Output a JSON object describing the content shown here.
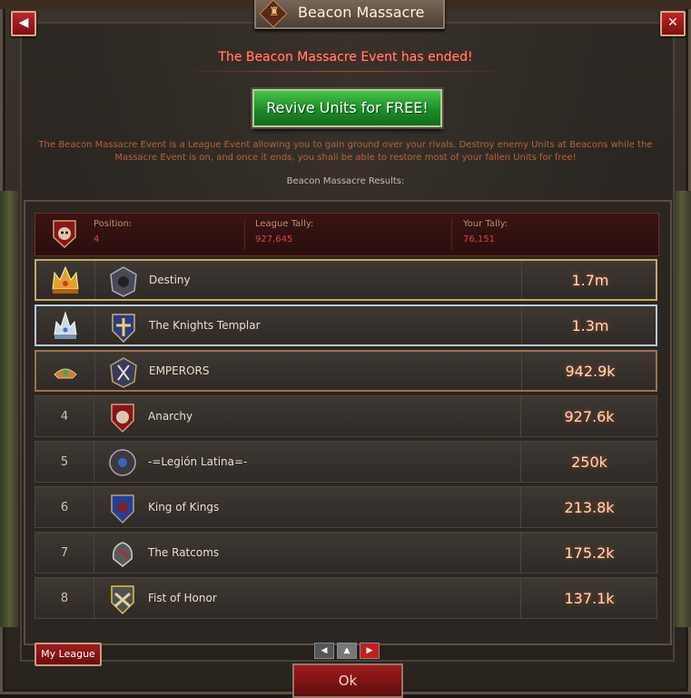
{
  "window": {
    "title": "Beacon Massacre",
    "back_label": "◀",
    "close_label": "✕"
  },
  "event": {
    "status_text": "The Beacon Massacre Event has ended!",
    "revive_label": "Revive Units for FREE!",
    "description": "The Beacon Massacre Event is a League Event allowing you to gain ground over your rivals. Destroy enemy Units at Beacons while the Massacre Event is on, and once it ends, you shall be able to restore most of your fallen Units for free!",
    "results_title": "Beacon Massacre Results:"
  },
  "summary": {
    "position_label": "Position:",
    "position_value": "4",
    "league_tally_label": "League Tally:",
    "league_tally_value": "927,645",
    "your_tally_label": "Your Tally:",
    "your_tally_value": "76,151"
  },
  "leaderboard": [
    {
      "rank": "",
      "medal": "gold",
      "name": "Destiny",
      "score": "1.7m"
    },
    {
      "rank": "",
      "medal": "silver",
      "name": "The Knights Templar",
      "score": "1.3m"
    },
    {
      "rank": "",
      "medal": "bronze",
      "name": "EMPERORS",
      "score": "942.9k"
    },
    {
      "rank": "4",
      "medal": "",
      "name": "Anarchy",
      "score": "927.6k"
    },
    {
      "rank": "5",
      "medal": "",
      "name": "-=Legión Latina=-",
      "score": "250k"
    },
    {
      "rank": "6",
      "medal": "",
      "name": "King of Kings",
      "score": "213.8k"
    },
    {
      "rank": "7",
      "medal": "",
      "name": "The Ratcoms",
      "score": "175.2k"
    },
    {
      "rank": "8",
      "medal": "",
      "name": "Fist of Honor",
      "score": "137.1k"
    }
  ],
  "footer": {
    "my_league_label": "My League",
    "ok_label": "Ok",
    "prev_label": "◀",
    "top_label": "▲",
    "next_label": "▶"
  }
}
